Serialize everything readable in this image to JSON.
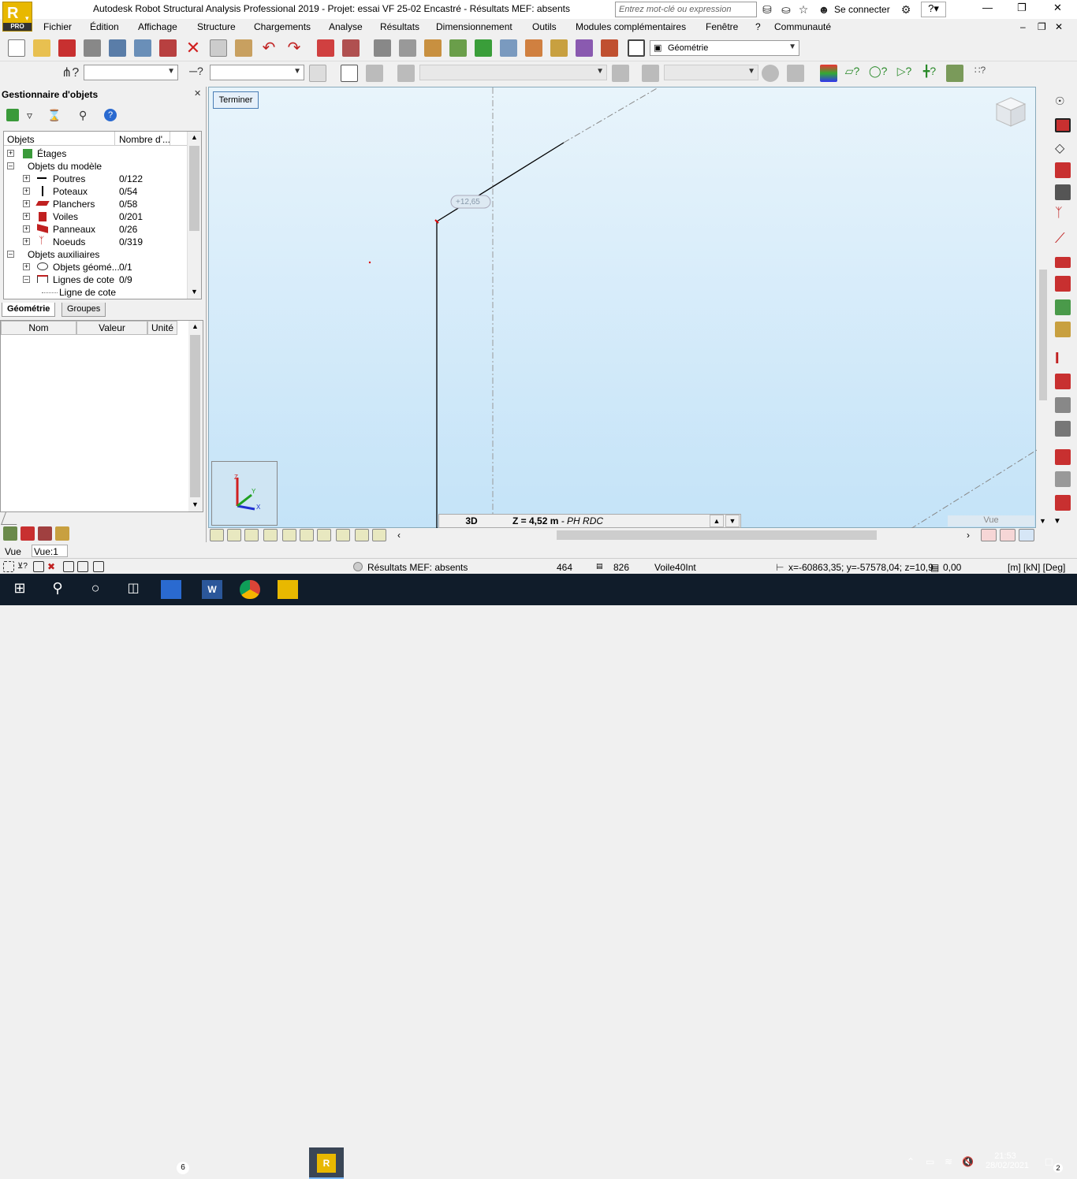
{
  "window": {
    "title": "Autodesk Robot Structural Analysis Professional 2019 - Projet: essai VF 25-02 Encastré - Résultats MEF: absents",
    "search_placeholder": "Entrez mot-clé ou expression",
    "signin": "Se connecter",
    "logo": "R",
    "logo_sub": "PRO"
  },
  "menu": [
    "Fichier",
    "Édition",
    "Affichage",
    "Structure",
    "Chargements",
    "Analyse",
    "Résultats",
    "Dimensionnement",
    "Outils",
    "Modules complémentaires",
    "Fenêtre",
    "?",
    "Communauté"
  ],
  "toolbar": {
    "layout_combo": "Géométrie"
  },
  "object_manager": {
    "title": "Gestionnaire d'objets",
    "col_objects": "Objets",
    "col_count": "Nombre d'...",
    "tree": [
      {
        "label": "Étages",
        "count": "",
        "level": 0
      },
      {
        "label": "Objets du modèle",
        "count": "",
        "level": 0
      },
      {
        "label": "Poutres",
        "count": "0/122",
        "level": 1
      },
      {
        "label": "Poteaux",
        "count": "0/54",
        "level": 1
      },
      {
        "label": "Planchers",
        "count": "0/58",
        "level": 1
      },
      {
        "label": "Voiles",
        "count": "0/201",
        "level": 1
      },
      {
        "label": "Panneaux",
        "count": "0/26",
        "level": 1
      },
      {
        "label": "Noeuds",
        "count": "0/319",
        "level": 1
      },
      {
        "label": "Objets auxiliaires",
        "count": "",
        "level": 0
      },
      {
        "label": "Objets géomé...",
        "count": "0/1",
        "level": 1
      },
      {
        "label": "Lignes de cote",
        "count": "0/9",
        "level": 1
      },
      {
        "label": "Ligne de cote",
        "count": "",
        "level": 2
      }
    ],
    "tabs": [
      "Géométrie",
      "Groupes"
    ],
    "props_headers": [
      "Nom",
      "Valeur",
      "Unité"
    ]
  },
  "canvas": {
    "terminer": "Terminer",
    "level_tag": "+12,65",
    "view_mode": "3D",
    "z_value": "Z = 4,52 m",
    "z_level": "- PH RDC",
    "view_label": "Vue"
  },
  "vue_row": {
    "label": "Vue",
    "value": "Vue:1"
  },
  "status": {
    "results": "Résultats MEF: absents",
    "n1": "464",
    "n2": "826",
    "obj": "Voile40Int",
    "coords": "x=-60863,35; y=-57578,04; z=10,9",
    "offset": "0,00",
    "units": "[m] [kN] [Deg]"
  },
  "taskbar": {
    "mail_badge": "6",
    "time": "21:53",
    "date": "28/02/2021",
    "notif": "2"
  },
  "colors": {
    "accent": "#e8b800",
    "canvas_top": "#e8f4fb",
    "canvas_bottom": "#c4e3f8",
    "taskbar": "#101c2a"
  }
}
